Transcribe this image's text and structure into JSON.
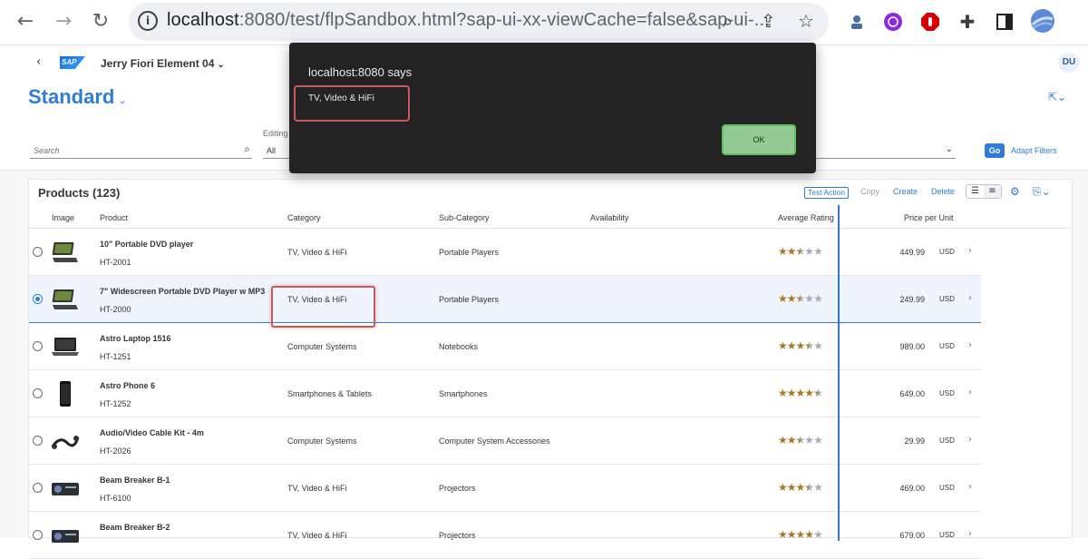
{
  "browser": {
    "url_host": "localhost",
    "url_rest": ":8080/test/flpSandbox.html?sap-ui-xx-viewCache=false&sap-ui-..."
  },
  "shell": {
    "app_title": "Jerry Fiori Element 04",
    "logo_text": "SAP",
    "avatar_initials": "DU"
  },
  "variant": {
    "title": "Standard"
  },
  "filterbar": {
    "search_placeholder": "Search",
    "editing_label": "Editing",
    "editing_value": "All",
    "go_label": "Go",
    "adapt_label": "Adapt Filters"
  },
  "table": {
    "title": "Products (123)",
    "actions": {
      "test_action": "Test Action",
      "copy": "Copy",
      "create": "Create",
      "delete": "Delete"
    },
    "columns": {
      "image": "Image",
      "product": "Product",
      "category": "Category",
      "subcategory": "Sub-Category",
      "availability": "Availability",
      "rating": "Average Rating",
      "price": "Price per Unit"
    },
    "rows": [
      {
        "name": "10\" Portable DVD player",
        "id": "HT-2001",
        "category": "TV, Video & HiFi",
        "subcategory": "Portable Players",
        "rating": 2.5,
        "price": "449.99",
        "currency": "USD",
        "selected": false,
        "image": "dvd-player"
      },
      {
        "name": "7\" Widescreen Portable DVD Player w MP3",
        "id": "HT-2000",
        "category": "TV, Video & HiFi",
        "subcategory": "Portable Players",
        "rating": 2.5,
        "price": "249.99",
        "currency": "USD",
        "selected": true,
        "image": "dvd-player"
      },
      {
        "name": "Astro Laptop 1516",
        "id": "HT-1251",
        "category": "Computer Systems",
        "subcategory": "Notebooks",
        "rating": 3.5,
        "price": "989.00",
        "currency": "USD",
        "selected": false,
        "image": "laptop"
      },
      {
        "name": "Astro Phone 6",
        "id": "HT-1252",
        "category": "Smartphones & Tablets",
        "subcategory": "Smartphones",
        "rating": 4.5,
        "price": "649.00",
        "currency": "USD",
        "selected": false,
        "image": "phone"
      },
      {
        "name": "Audio/Video Cable Kit - 4m",
        "id": "HT-2026",
        "category": "Computer Systems",
        "subcategory": "Computer System Accessories",
        "rating": 2.5,
        "price": "29.99",
        "currency": "USD",
        "selected": false,
        "image": "cable"
      },
      {
        "name": "Beam Breaker B-1",
        "id": "HT-6100",
        "category": "TV, Video & HiFi",
        "subcategory": "Projectors",
        "rating": 3.5,
        "price": "469.00",
        "currency": "USD",
        "selected": false,
        "image": "projector"
      },
      {
        "name": "Beam Breaker B-2",
        "id": "",
        "category": "TV, Video & HiFi",
        "subcategory": "Projectors",
        "rating": 4,
        "price": "679.00",
        "currency": "USD",
        "selected": false,
        "image": "projector"
      }
    ]
  },
  "dialog": {
    "title": "localhost:8080 says",
    "message": "TV, Video & HiFi",
    "ok_label": "OK"
  }
}
